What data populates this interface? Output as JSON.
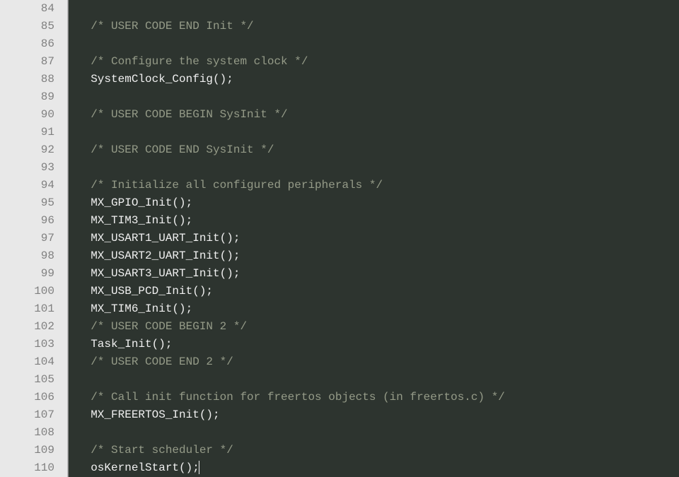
{
  "editor": {
    "first_line_number": 84,
    "lines": [
      {
        "indent": 0,
        "tokens": []
      },
      {
        "indent": 2,
        "tokens": [
          {
            "cls": "comment",
            "text": "/* USER CODE END Init */"
          }
        ]
      },
      {
        "indent": 0,
        "tokens": []
      },
      {
        "indent": 2,
        "tokens": [
          {
            "cls": "comment",
            "text": "/* Configure the system clock */"
          }
        ]
      },
      {
        "indent": 2,
        "tokens": [
          {
            "cls": "code",
            "text": "SystemClock_Config();"
          }
        ]
      },
      {
        "indent": 0,
        "tokens": []
      },
      {
        "indent": 2,
        "tokens": [
          {
            "cls": "comment",
            "text": "/* USER CODE BEGIN SysInit */"
          }
        ]
      },
      {
        "indent": 0,
        "tokens": []
      },
      {
        "indent": 2,
        "tokens": [
          {
            "cls": "comment",
            "text": "/* USER CODE END SysInit */"
          }
        ]
      },
      {
        "indent": 0,
        "tokens": []
      },
      {
        "indent": 2,
        "tokens": [
          {
            "cls": "comment",
            "text": "/* Initialize all configured peripherals */"
          }
        ]
      },
      {
        "indent": 2,
        "tokens": [
          {
            "cls": "code",
            "text": "MX_GPIO_Init();"
          }
        ]
      },
      {
        "indent": 2,
        "tokens": [
          {
            "cls": "code",
            "text": "MX_TIM3_Init();"
          }
        ]
      },
      {
        "indent": 2,
        "tokens": [
          {
            "cls": "code",
            "text": "MX_USART1_UART_Init();"
          }
        ]
      },
      {
        "indent": 2,
        "tokens": [
          {
            "cls": "code",
            "text": "MX_USART2_UART_Init();"
          }
        ]
      },
      {
        "indent": 2,
        "tokens": [
          {
            "cls": "code",
            "text": "MX_USART3_UART_Init();"
          }
        ]
      },
      {
        "indent": 2,
        "tokens": [
          {
            "cls": "code",
            "text": "MX_USB_PCD_Init();"
          }
        ]
      },
      {
        "indent": 2,
        "tokens": [
          {
            "cls": "code",
            "text": "MX_TIM6_Init();"
          }
        ]
      },
      {
        "indent": 2,
        "tokens": [
          {
            "cls": "comment",
            "text": "/* USER CODE BEGIN 2 */"
          }
        ]
      },
      {
        "indent": 2,
        "tokens": [
          {
            "cls": "code",
            "text": "Task_Init();"
          }
        ]
      },
      {
        "indent": 2,
        "tokens": [
          {
            "cls": "comment",
            "text": "/* USER CODE END 2 */"
          }
        ]
      },
      {
        "indent": 0,
        "tokens": []
      },
      {
        "indent": 2,
        "tokens": [
          {
            "cls": "comment",
            "text": "/* Call init function for freertos objects (in freertos.c) */"
          }
        ]
      },
      {
        "indent": 2,
        "tokens": [
          {
            "cls": "code",
            "text": "MX_FREERTOS_Init();"
          }
        ]
      },
      {
        "indent": 0,
        "tokens": []
      },
      {
        "indent": 2,
        "tokens": [
          {
            "cls": "comment",
            "text": "/* Start scheduler */"
          }
        ]
      },
      {
        "indent": 2,
        "tokens": [
          {
            "cls": "code",
            "text": "osKernelStart();"
          }
        ],
        "caret_after": true
      }
    ]
  }
}
